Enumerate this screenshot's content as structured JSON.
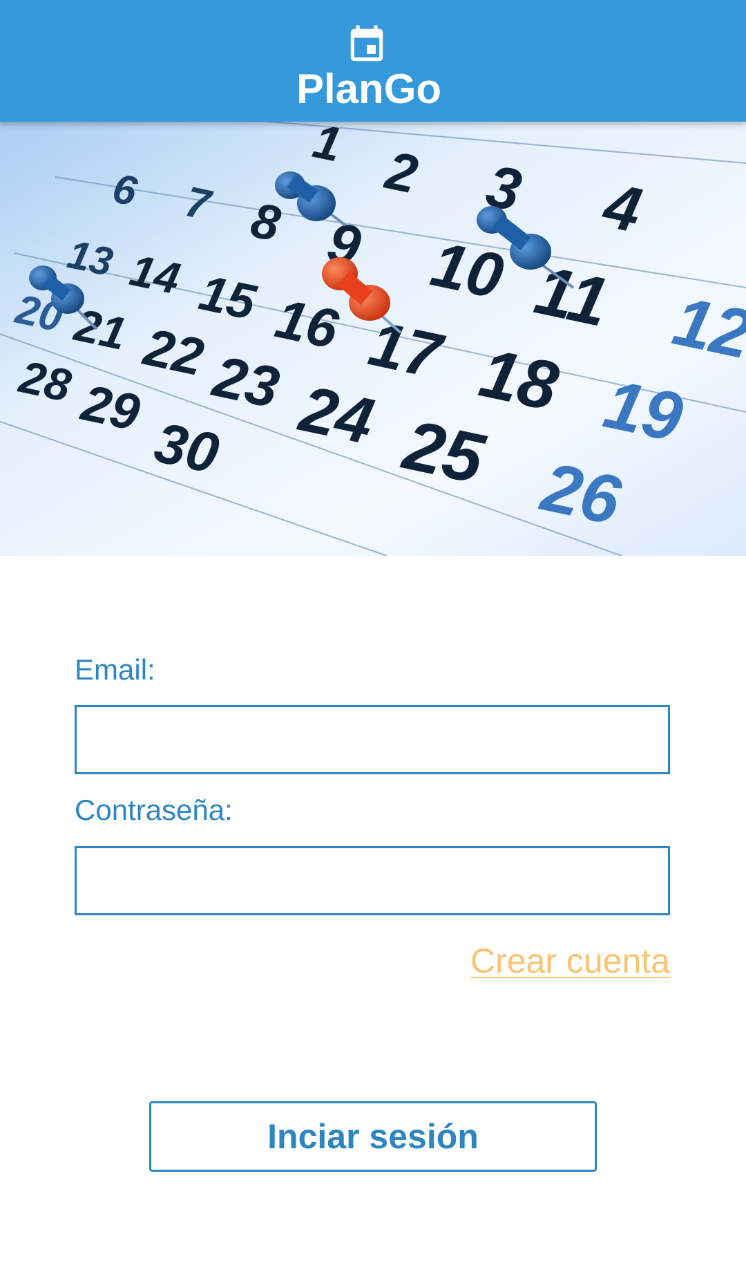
{
  "header": {
    "title": "PlanGo",
    "icon": "calendar-icon"
  },
  "hero": {
    "image": "calendar-with-pushpins",
    "calendar_days": [
      "1",
      "2",
      "3",
      "4",
      "6",
      "7",
      "8",
      "9",
      "10",
      "11",
      "12",
      "13",
      "14",
      "15",
      "16",
      "17",
      "18",
      "19",
      "20",
      "21",
      "22",
      "23",
      "24",
      "25",
      "26",
      "28",
      "29",
      "30"
    ],
    "pins": [
      {
        "color": "#1f5fa8",
        "day": "8"
      },
      {
        "color": "#1f5fa8",
        "day": "10"
      },
      {
        "color": "#1f5fa8",
        "day": "20"
      },
      {
        "color": "#e8401c",
        "day": "16"
      }
    ]
  },
  "form": {
    "email_label": "Email:",
    "email_value": "",
    "password_label": "Contraseña:",
    "password_value": "",
    "create_account_link": "Crear cuenta",
    "login_button": "Inciar sesión"
  },
  "colors": {
    "header_bg": "#3498db",
    "primary": "#2e86c1",
    "link": "#f8c471",
    "pin_blue": "#1f5fa8",
    "pin_red": "#e8401c"
  }
}
